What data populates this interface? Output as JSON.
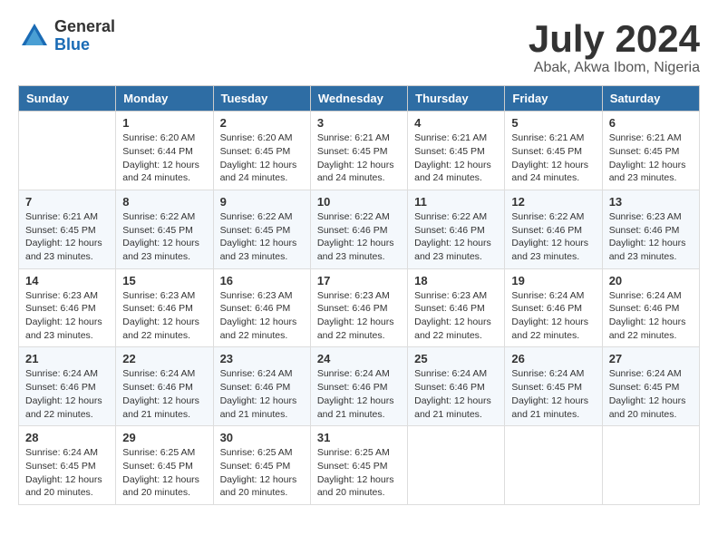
{
  "header": {
    "logo_general": "General",
    "logo_blue": "Blue",
    "title": "July 2024",
    "subtitle": "Abak, Akwa Ibom, Nigeria"
  },
  "days_of_week": [
    "Sunday",
    "Monday",
    "Tuesday",
    "Wednesday",
    "Thursday",
    "Friday",
    "Saturday"
  ],
  "weeks": [
    [
      {
        "num": "",
        "info": ""
      },
      {
        "num": "1",
        "info": "Sunrise: 6:20 AM\nSunset: 6:44 PM\nDaylight: 12 hours\nand 24 minutes."
      },
      {
        "num": "2",
        "info": "Sunrise: 6:20 AM\nSunset: 6:45 PM\nDaylight: 12 hours\nand 24 minutes."
      },
      {
        "num": "3",
        "info": "Sunrise: 6:21 AM\nSunset: 6:45 PM\nDaylight: 12 hours\nand 24 minutes."
      },
      {
        "num": "4",
        "info": "Sunrise: 6:21 AM\nSunset: 6:45 PM\nDaylight: 12 hours\nand 24 minutes."
      },
      {
        "num": "5",
        "info": "Sunrise: 6:21 AM\nSunset: 6:45 PM\nDaylight: 12 hours\nand 24 minutes."
      },
      {
        "num": "6",
        "info": "Sunrise: 6:21 AM\nSunset: 6:45 PM\nDaylight: 12 hours\nand 23 minutes."
      }
    ],
    [
      {
        "num": "7",
        "info": "Sunrise: 6:21 AM\nSunset: 6:45 PM\nDaylight: 12 hours\nand 23 minutes."
      },
      {
        "num": "8",
        "info": "Sunrise: 6:22 AM\nSunset: 6:45 PM\nDaylight: 12 hours\nand 23 minutes."
      },
      {
        "num": "9",
        "info": "Sunrise: 6:22 AM\nSunset: 6:45 PM\nDaylight: 12 hours\nand 23 minutes."
      },
      {
        "num": "10",
        "info": "Sunrise: 6:22 AM\nSunset: 6:46 PM\nDaylight: 12 hours\nand 23 minutes."
      },
      {
        "num": "11",
        "info": "Sunrise: 6:22 AM\nSunset: 6:46 PM\nDaylight: 12 hours\nand 23 minutes."
      },
      {
        "num": "12",
        "info": "Sunrise: 6:22 AM\nSunset: 6:46 PM\nDaylight: 12 hours\nand 23 minutes."
      },
      {
        "num": "13",
        "info": "Sunrise: 6:23 AM\nSunset: 6:46 PM\nDaylight: 12 hours\nand 23 minutes."
      }
    ],
    [
      {
        "num": "14",
        "info": "Sunrise: 6:23 AM\nSunset: 6:46 PM\nDaylight: 12 hours\nand 23 minutes."
      },
      {
        "num": "15",
        "info": "Sunrise: 6:23 AM\nSunset: 6:46 PM\nDaylight: 12 hours\nand 22 minutes."
      },
      {
        "num": "16",
        "info": "Sunrise: 6:23 AM\nSunset: 6:46 PM\nDaylight: 12 hours\nand 22 minutes."
      },
      {
        "num": "17",
        "info": "Sunrise: 6:23 AM\nSunset: 6:46 PM\nDaylight: 12 hours\nand 22 minutes."
      },
      {
        "num": "18",
        "info": "Sunrise: 6:23 AM\nSunset: 6:46 PM\nDaylight: 12 hours\nand 22 minutes."
      },
      {
        "num": "19",
        "info": "Sunrise: 6:24 AM\nSunset: 6:46 PM\nDaylight: 12 hours\nand 22 minutes."
      },
      {
        "num": "20",
        "info": "Sunrise: 6:24 AM\nSunset: 6:46 PM\nDaylight: 12 hours\nand 22 minutes."
      }
    ],
    [
      {
        "num": "21",
        "info": "Sunrise: 6:24 AM\nSunset: 6:46 PM\nDaylight: 12 hours\nand 22 minutes."
      },
      {
        "num": "22",
        "info": "Sunrise: 6:24 AM\nSunset: 6:46 PM\nDaylight: 12 hours\nand 21 minutes."
      },
      {
        "num": "23",
        "info": "Sunrise: 6:24 AM\nSunset: 6:46 PM\nDaylight: 12 hours\nand 21 minutes."
      },
      {
        "num": "24",
        "info": "Sunrise: 6:24 AM\nSunset: 6:46 PM\nDaylight: 12 hours\nand 21 minutes."
      },
      {
        "num": "25",
        "info": "Sunrise: 6:24 AM\nSunset: 6:46 PM\nDaylight: 12 hours\nand 21 minutes."
      },
      {
        "num": "26",
        "info": "Sunrise: 6:24 AM\nSunset: 6:45 PM\nDaylight: 12 hours\nand 21 minutes."
      },
      {
        "num": "27",
        "info": "Sunrise: 6:24 AM\nSunset: 6:45 PM\nDaylight: 12 hours\nand 20 minutes."
      }
    ],
    [
      {
        "num": "28",
        "info": "Sunrise: 6:24 AM\nSunset: 6:45 PM\nDaylight: 12 hours\nand 20 minutes."
      },
      {
        "num": "29",
        "info": "Sunrise: 6:25 AM\nSunset: 6:45 PM\nDaylight: 12 hours\nand 20 minutes."
      },
      {
        "num": "30",
        "info": "Sunrise: 6:25 AM\nSunset: 6:45 PM\nDaylight: 12 hours\nand 20 minutes."
      },
      {
        "num": "31",
        "info": "Sunrise: 6:25 AM\nSunset: 6:45 PM\nDaylight: 12 hours\nand 20 minutes."
      },
      {
        "num": "",
        "info": ""
      },
      {
        "num": "",
        "info": ""
      },
      {
        "num": "",
        "info": ""
      }
    ]
  ]
}
